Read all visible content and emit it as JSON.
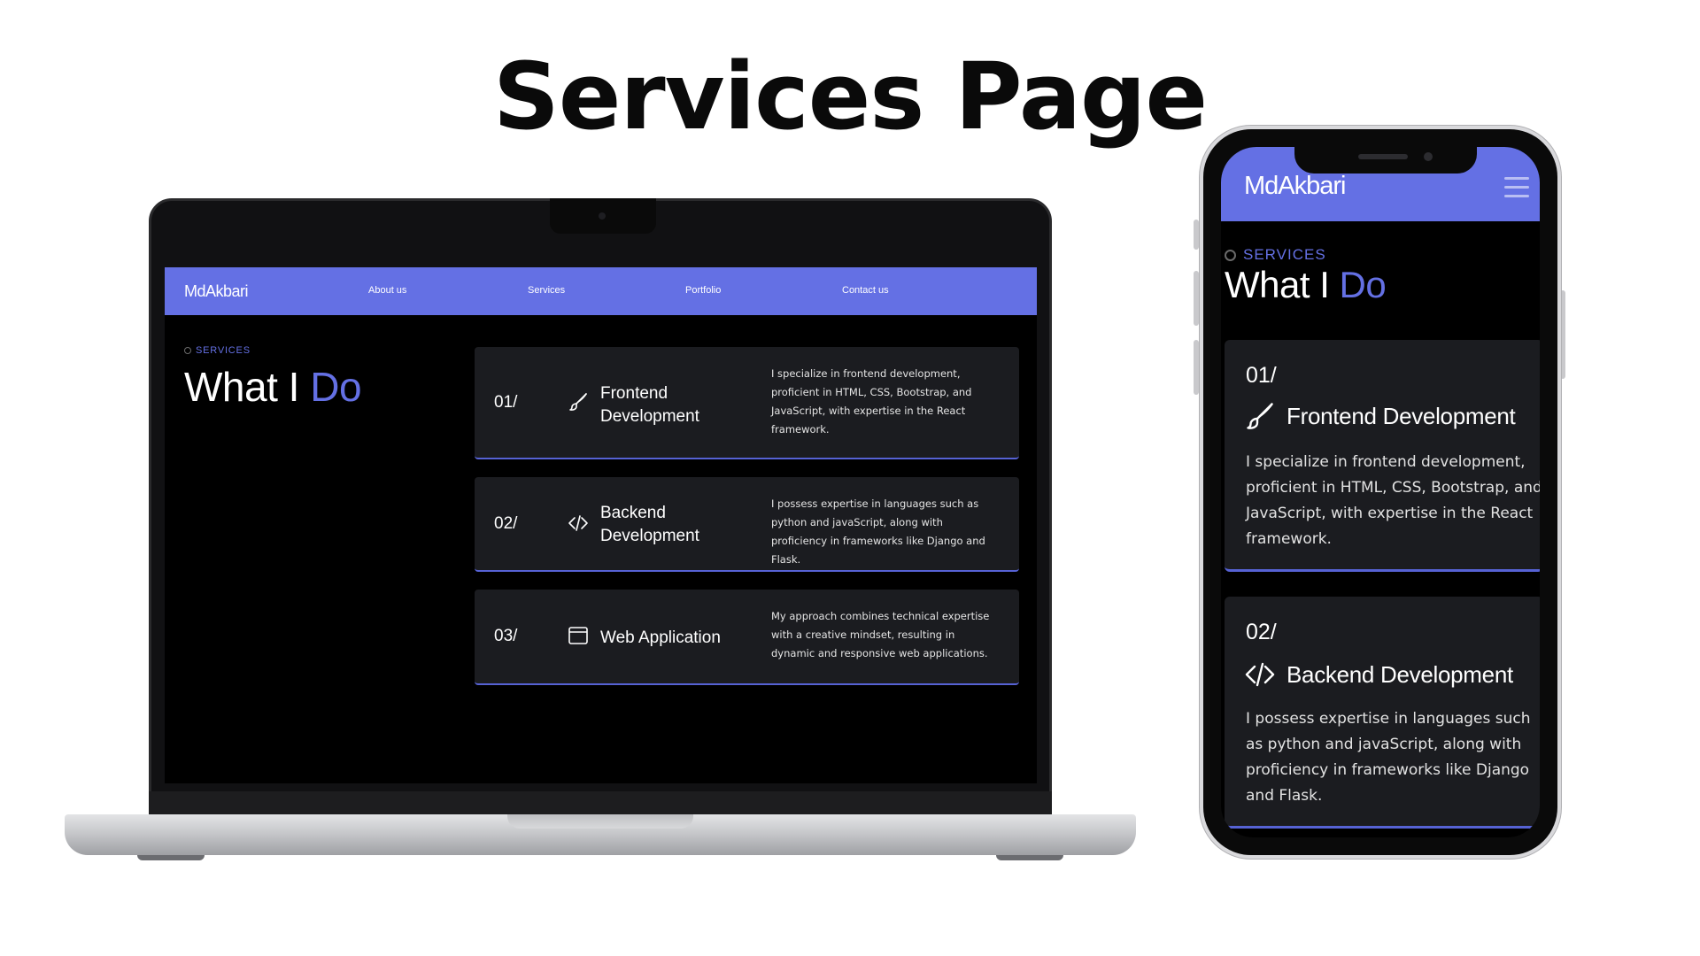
{
  "headline": "Services Page",
  "desktop": {
    "nav": {
      "logo": "MdAkbari",
      "links": [
        "About us",
        "Services",
        "Portfolio",
        "Contact us"
      ]
    },
    "section_tag": "SERVICES",
    "heading_main": "What I ",
    "heading_accent": "Do",
    "services": [
      {
        "number": "01/",
        "icon": "brush-icon",
        "title": "Frontend Development",
        "description": "I specialize in frontend development, proficient in HTML, CSS, Bootstrap, and JavaScript, with expertise in the React framework."
      },
      {
        "number": "02/",
        "icon": "code-icon",
        "title": "Backend Development",
        "description": "I possess expertise in languages such as python and javaScript, along with proficiency in frameworks like Django and Flask."
      },
      {
        "number": "03/",
        "icon": "browser-window-icon",
        "title": "Web Application",
        "description": "My approach combines technical expertise with a creative mindset, resulting in dynamic and responsive web applications."
      }
    ]
  },
  "mobile": {
    "nav": {
      "logo": "MdAkbari",
      "menu_icon": "hamburger-menu-icon"
    },
    "section_tag": "SERVICES",
    "heading_main": "What I ",
    "heading_accent": "Do",
    "services": [
      {
        "number": "01/",
        "icon": "brush-icon",
        "title": "Frontend Development",
        "description": "I specialize in frontend development, proficient in HTML, CSS, Bootstrap, and JavaScript, with expertise in the React framework."
      },
      {
        "number": "02/",
        "icon": "code-icon",
        "title": "Backend Development",
        "description": "I possess expertise in languages such as python and javaScript, along with proficiency in frameworks like Django and Flask."
      }
    ]
  },
  "colors": {
    "accent": "#6470e4",
    "card_background": "#1b1c20",
    "page_background": "#000000"
  }
}
